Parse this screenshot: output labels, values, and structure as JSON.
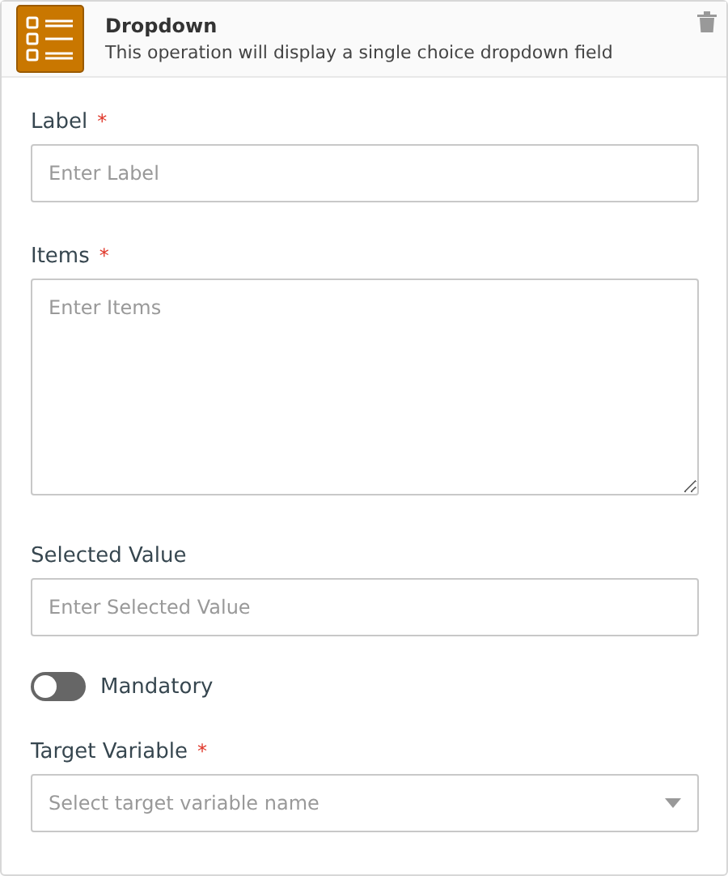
{
  "header": {
    "title": "Dropdown",
    "description": "This operation will display a single choice dropdown field"
  },
  "fields": [
    {
      "kind": "text",
      "label": "Label",
      "required_mark": "*",
      "placeholder": "Enter Label"
    },
    {
      "kind": "textarea",
      "label": "Items",
      "required_mark": "*",
      "placeholder": "Enter Items"
    },
    {
      "kind": "text",
      "label": "Selected Value",
      "placeholder": "Enter Selected Value"
    },
    {
      "kind": "toggle",
      "label": "Mandatory",
      "on": false
    },
    {
      "kind": "select",
      "label": "Target Variable",
      "required_mark": "*",
      "placeholder": "Select target variable name"
    }
  ]
}
